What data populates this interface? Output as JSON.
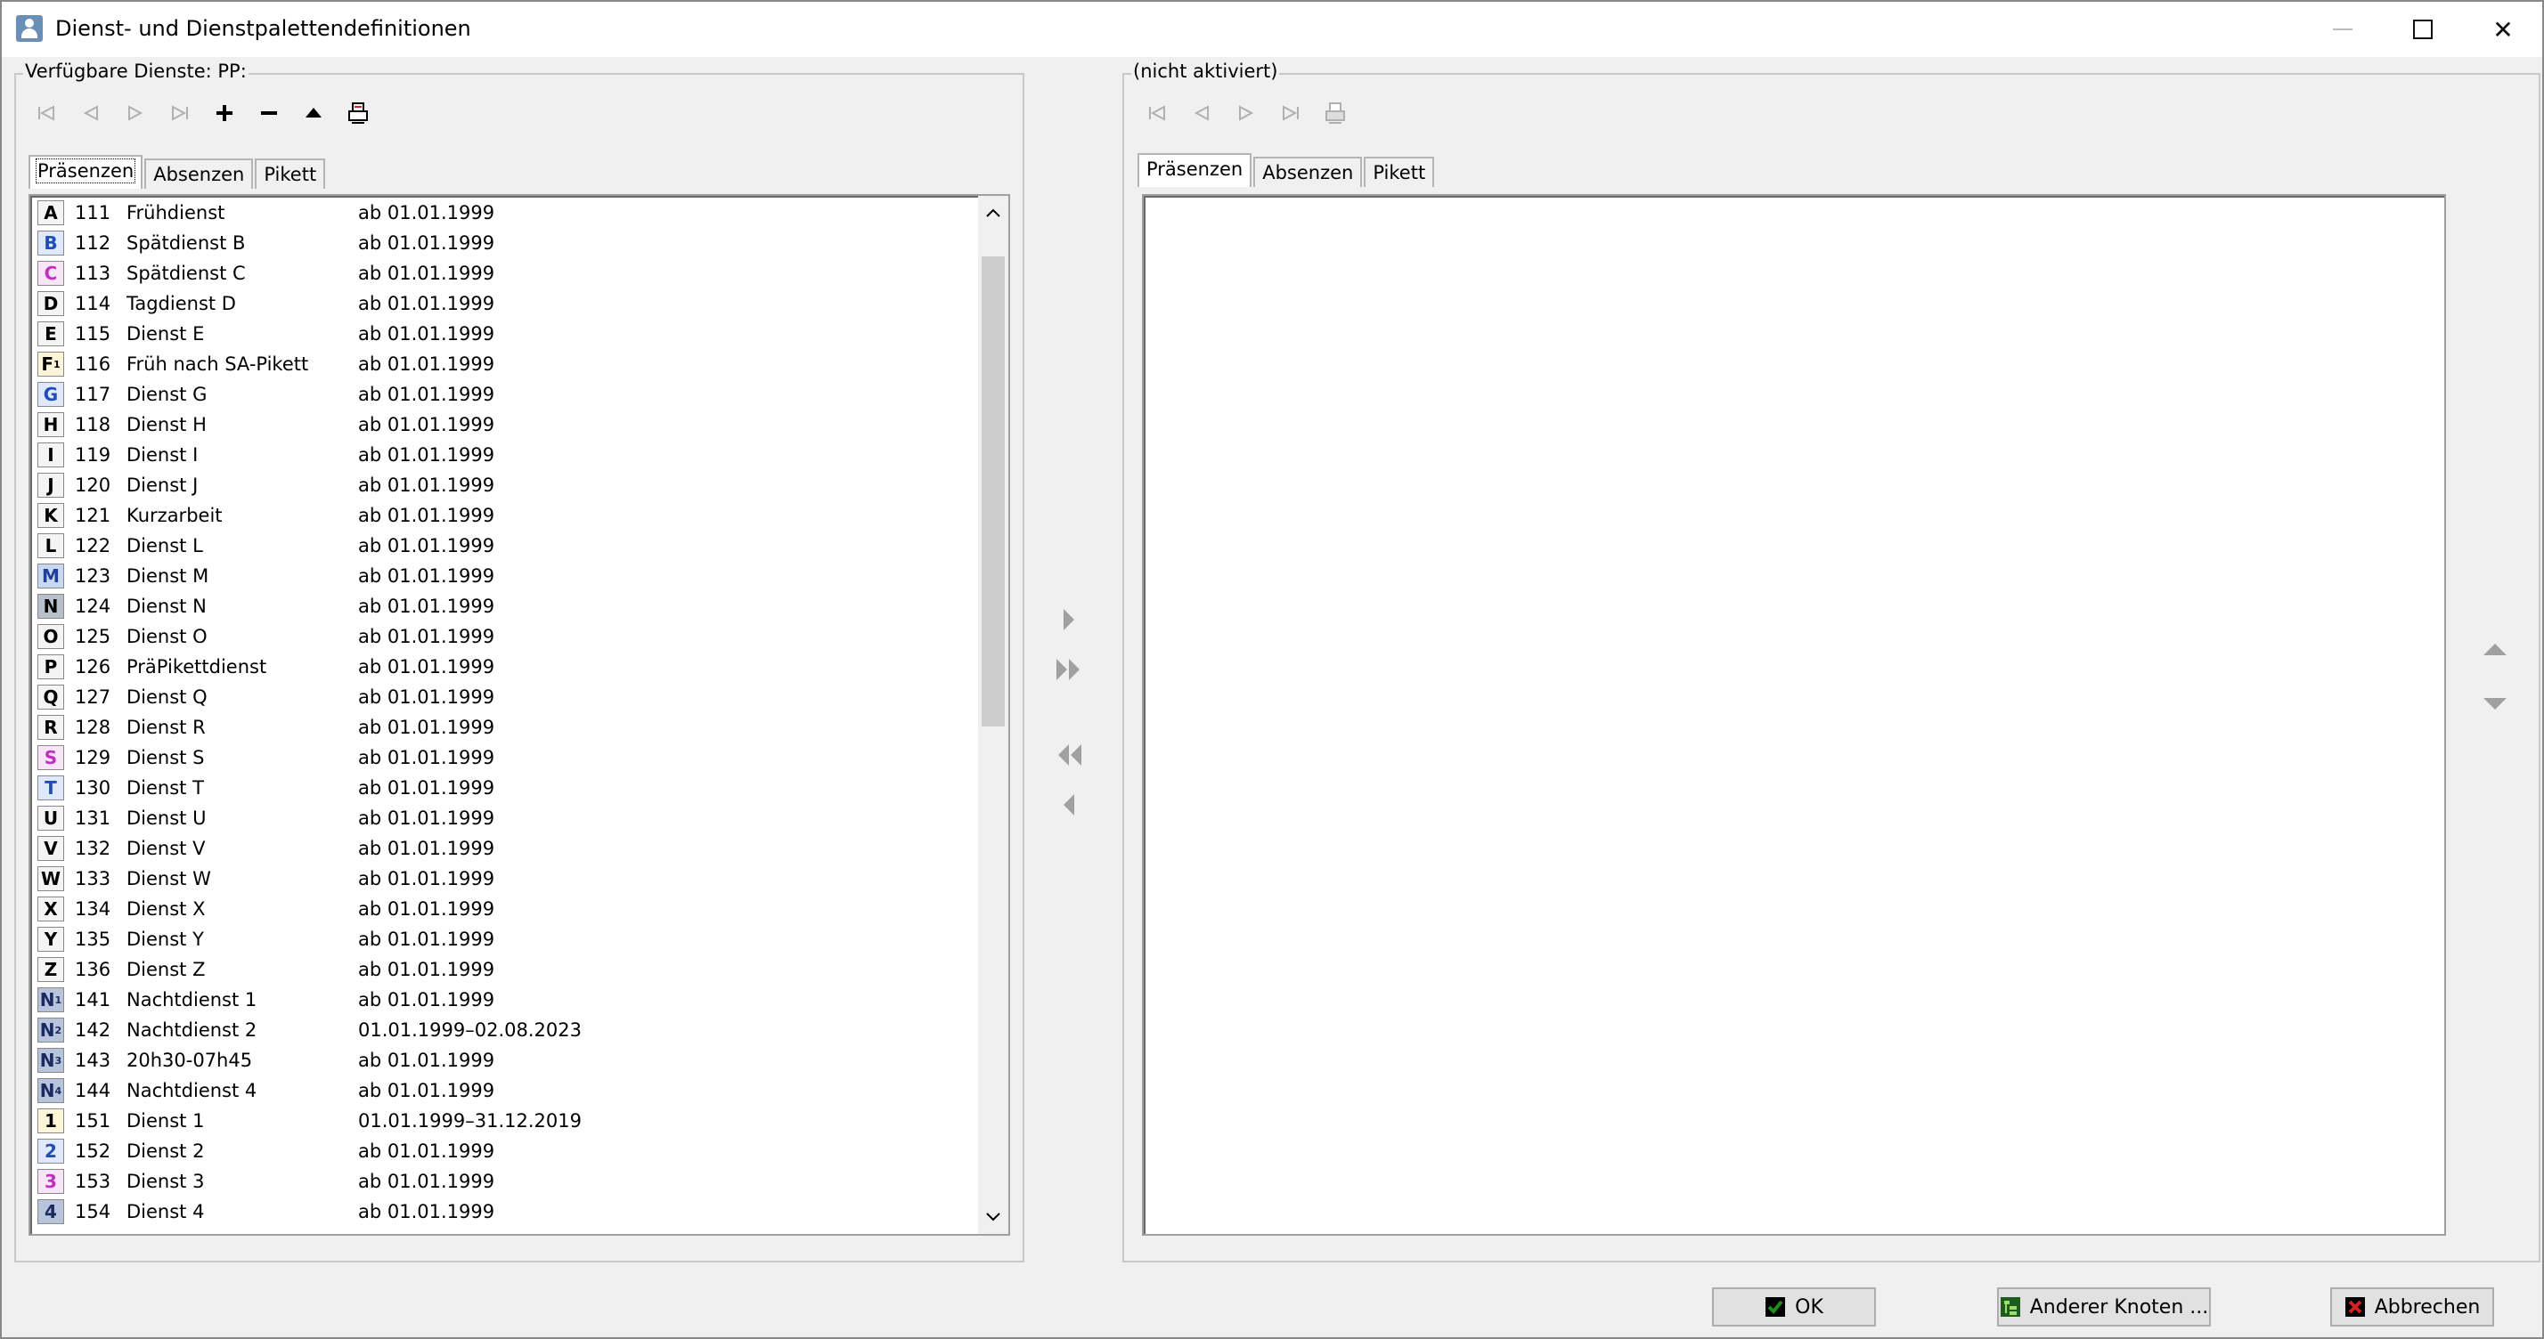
{
  "window": {
    "title": "Dienst- und Dienstpalettendefinitionen",
    "close_glyph": "✕"
  },
  "left_panel": {
    "group_label": "Verfügbare Dienste: PP:",
    "tabs": [
      {
        "label": "Präsenzen",
        "active": true
      },
      {
        "label": "Absenzen",
        "active": false
      },
      {
        "label": "Pikett",
        "active": false
      }
    ],
    "rows": [
      {
        "code": "A",
        "sub": "",
        "color": "#000000",
        "bg": "#f4f4f4",
        "num": "111",
        "name": "Frühdienst",
        "valid": "ab 01.01.1999"
      },
      {
        "code": "B",
        "sub": "",
        "color": "#1f4fb5",
        "bg": "#dfe9fb",
        "num": "112",
        "name": "Spätdienst B",
        "valid": "ab 01.01.1999"
      },
      {
        "code": "C",
        "sub": "",
        "color": "#c030c0",
        "bg": "#f8e6f8",
        "num": "113",
        "name": "Spätdienst C",
        "valid": "ab 01.01.1999"
      },
      {
        "code": "D",
        "sub": "",
        "color": "#000000",
        "bg": "#f4f4f4",
        "num": "114",
        "name": "Tagdienst D",
        "valid": "ab 01.01.1999"
      },
      {
        "code": "E",
        "sub": "",
        "color": "#000000",
        "bg": "#f4f4f4",
        "num": "115",
        "name": "Dienst E",
        "valid": "ab 01.01.1999"
      },
      {
        "code": "F",
        "sub": "1",
        "color": "#000000",
        "bg": "#fdf5d8",
        "num": "116",
        "name": "Früh nach SA-Pikett",
        "valid": "ab 01.01.1999"
      },
      {
        "code": "G",
        "sub": "",
        "color": "#1f4fb5",
        "bg": "#dfe9fb",
        "num": "117",
        "name": "Dienst G",
        "valid": "ab 01.01.1999"
      },
      {
        "code": "H",
        "sub": "",
        "color": "#000000",
        "bg": "#f4f4f4",
        "num": "118",
        "name": "Dienst H",
        "valid": "ab 01.01.1999"
      },
      {
        "code": "I",
        "sub": "",
        "color": "#000000",
        "bg": "#f4f4f4",
        "num": "119",
        "name": "Dienst I",
        "valid": "ab 01.01.1999"
      },
      {
        "code": "J",
        "sub": "",
        "color": "#000000",
        "bg": "#f4f4f4",
        "num": "120",
        "name": "Dienst J",
        "valid": "ab 01.01.1999"
      },
      {
        "code": "K",
        "sub": "",
        "color": "#000000",
        "bg": "#f4f4f4",
        "num": "121",
        "name": "Kurzarbeit",
        "valid": "ab 01.01.1999"
      },
      {
        "code": "L",
        "sub": "",
        "color": "#000000",
        "bg": "#f4f4f4",
        "num": "122",
        "name": "Dienst L",
        "valid": "ab 01.01.1999"
      },
      {
        "code": "M",
        "sub": "",
        "color": "#1f3f9a",
        "bg": "#c8d8f4",
        "num": "123",
        "name": "Dienst M",
        "valid": "ab 01.01.1999"
      },
      {
        "code": "N",
        "sub": "",
        "color": "#000000",
        "bg": "#b8c0cc",
        "num": "124",
        "name": "Dienst N",
        "valid": "ab 01.01.1999"
      },
      {
        "code": "O",
        "sub": "",
        "color": "#000000",
        "bg": "#f4f4f4",
        "num": "125",
        "name": "Dienst O",
        "valid": "ab 01.01.1999"
      },
      {
        "code": "P",
        "sub": "",
        "color": "#000000",
        "bg": "#f4f4f4",
        "num": "126",
        "name": "PräPikettdienst",
        "valid": "ab 01.01.1999"
      },
      {
        "code": "Q",
        "sub": "",
        "color": "#000000",
        "bg": "#f4f4f4",
        "num": "127",
        "name": "Dienst Q",
        "valid": "ab 01.01.1999"
      },
      {
        "code": "R",
        "sub": "",
        "color": "#000000",
        "bg": "#f4f4f4",
        "num": "128",
        "name": "Dienst R",
        "valid": "ab 01.01.1999"
      },
      {
        "code": "S",
        "sub": "",
        "color": "#c030c0",
        "bg": "#f8e6f8",
        "num": "129",
        "name": "Dienst S",
        "valid": "ab 01.01.1999"
      },
      {
        "code": "T",
        "sub": "",
        "color": "#1f4fb5",
        "bg": "#dfe9fb",
        "num": "130",
        "name": "Dienst T",
        "valid": "ab 01.01.1999"
      },
      {
        "code": "U",
        "sub": "",
        "color": "#000000",
        "bg": "#f4f4f4",
        "num": "131",
        "name": "Dienst U",
        "valid": "ab 01.01.1999"
      },
      {
        "code": "V",
        "sub": "",
        "color": "#000000",
        "bg": "#f4f4f4",
        "num": "132",
        "name": "Dienst V",
        "valid": "ab 01.01.1999"
      },
      {
        "code": "W",
        "sub": "",
        "color": "#000000",
        "bg": "#f4f4f4",
        "num": "133",
        "name": "Dienst W",
        "valid": "ab 01.01.1999"
      },
      {
        "code": "X",
        "sub": "",
        "color": "#000000",
        "bg": "#f4f4f4",
        "num": "134",
        "name": "Dienst X",
        "valid": "ab 01.01.1999"
      },
      {
        "code": "Y",
        "sub": "",
        "color": "#000000",
        "bg": "#f4f4f4",
        "num": "135",
        "name": "Dienst Y",
        "valid": "ab 01.01.1999"
      },
      {
        "code": "Z",
        "sub": "",
        "color": "#000000",
        "bg": "#f4f4f4",
        "num": "136",
        "name": "Dienst Z",
        "valid": "ab 01.01.1999"
      },
      {
        "code": "N",
        "sub": "1",
        "color": "#1a2a60",
        "bg": "#b8c4dc",
        "num": "141",
        "name": "Nachtdienst 1",
        "valid": "ab 01.01.1999"
      },
      {
        "code": "N",
        "sub": "2",
        "color": "#1a2a60",
        "bg": "#b8c4dc",
        "num": "142",
        "name": "Nachtdienst 2",
        "valid": "01.01.1999–02.08.2023"
      },
      {
        "code": "N",
        "sub": "3",
        "color": "#1a2a60",
        "bg": "#b8c4dc",
        "num": "143",
        "name": "20h30-07h45",
        "valid": "ab 01.01.1999"
      },
      {
        "code": "N",
        "sub": "4",
        "color": "#1a2a60",
        "bg": "#b8c4dc",
        "num": "144",
        "name": "Nachtdienst 4",
        "valid": "ab 01.01.1999"
      },
      {
        "code": "1",
        "sub": "",
        "color": "#000000",
        "bg": "#fdf5d8",
        "num": "151",
        "name": "Dienst 1",
        "valid": "01.01.1999–31.12.2019"
      },
      {
        "code": "2",
        "sub": "",
        "color": "#1f4fb5",
        "bg": "#dfe9fb",
        "num": "152",
        "name": "Dienst 2",
        "valid": "ab 01.01.1999"
      },
      {
        "code": "3",
        "sub": "",
        "color": "#c030c0",
        "bg": "#f8e6f8",
        "num": "153",
        "name": "Dienst 3",
        "valid": "ab 01.01.1999"
      },
      {
        "code": "4",
        "sub": "",
        "color": "#1a2a60",
        "bg": "#b8c4dc",
        "num": "154",
        "name": "Dienst 4",
        "valid": "ab 01.01.1999"
      }
    ]
  },
  "right_panel": {
    "group_label": "(nicht aktiviert)",
    "tabs": [
      {
        "label": "Präsenzen",
        "active": true
      },
      {
        "label": "Absenzen",
        "active": false
      },
      {
        "label": "Pikett",
        "active": false
      }
    ]
  },
  "buttons": {
    "ok": "OK",
    "other_node": "Anderer Knoten ...",
    "cancel": "Abbrechen"
  },
  "colors": {
    "ok_check": "#1e8c1e",
    "cancel_x": "#d42020",
    "disabled": "#b0b0b0",
    "arrow": "#a0a0a0"
  }
}
